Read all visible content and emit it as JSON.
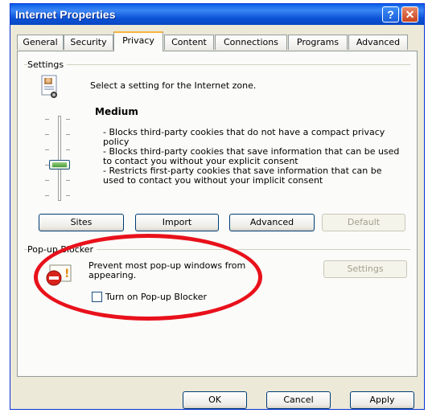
{
  "window": {
    "title": "Internet Properties",
    "help_glyph": "?",
    "close_glyph": "✕"
  },
  "tabs": [
    {
      "label": "General"
    },
    {
      "label": "Security"
    },
    {
      "label": "Privacy"
    },
    {
      "label": "Content"
    },
    {
      "label": "Connections"
    },
    {
      "label": "Programs"
    },
    {
      "label": "Advanced"
    }
  ],
  "active_tab": "Privacy",
  "settings": {
    "group_label": "Settings",
    "intro": "Select a setting for the Internet zone.",
    "level": "Medium",
    "slider_level_fraction": 0.5,
    "descriptions": [
      "- Blocks third-party cookies that do not have a compact privacy policy",
      "- Blocks third-party cookies that save information that can be used to contact you without your explicit consent",
      "- Restricts first-party cookies that save information that can be used to contact you without your implicit consent"
    ],
    "buttons": {
      "sites": "Sites",
      "import": "Import",
      "advanced": "Advanced",
      "default": "Default"
    }
  },
  "popup": {
    "group_label": "Pop-up Blocker",
    "text": "Prevent most pop-up windows from appearing.",
    "settings_button": "Settings",
    "checkbox_label": "Turn on Pop-up Blocker",
    "checked": false
  },
  "footer": {
    "ok": "OK",
    "cancel": "Cancel",
    "apply": "Apply"
  },
  "colors": {
    "titlebar": "#0a5ee8",
    "annotation": "#e8111b",
    "dialog_bg": "#ece9d8"
  }
}
